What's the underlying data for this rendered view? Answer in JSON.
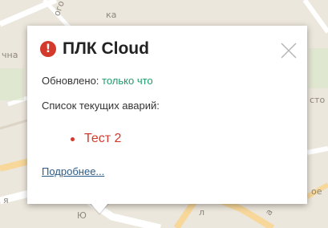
{
  "map": {
    "labels": [
      "чна",
      "ого",
      "ка",
      "сто",
      "я",
      "ое",
      "Ю",
      "л",
      "а"
    ]
  },
  "popup": {
    "icon": "alert-exclamation-icon",
    "title": "ПЛК Cloud",
    "updated_label": "Обновлено:",
    "updated_value": "только что",
    "list_title": "Список текущих аварий:",
    "alarms": [
      "Тест 2"
    ],
    "more_link": "Подробнее..."
  },
  "colors": {
    "alert": "#d33a2c",
    "updated_value": "#1f9a6b",
    "link": "#2c5d88"
  }
}
